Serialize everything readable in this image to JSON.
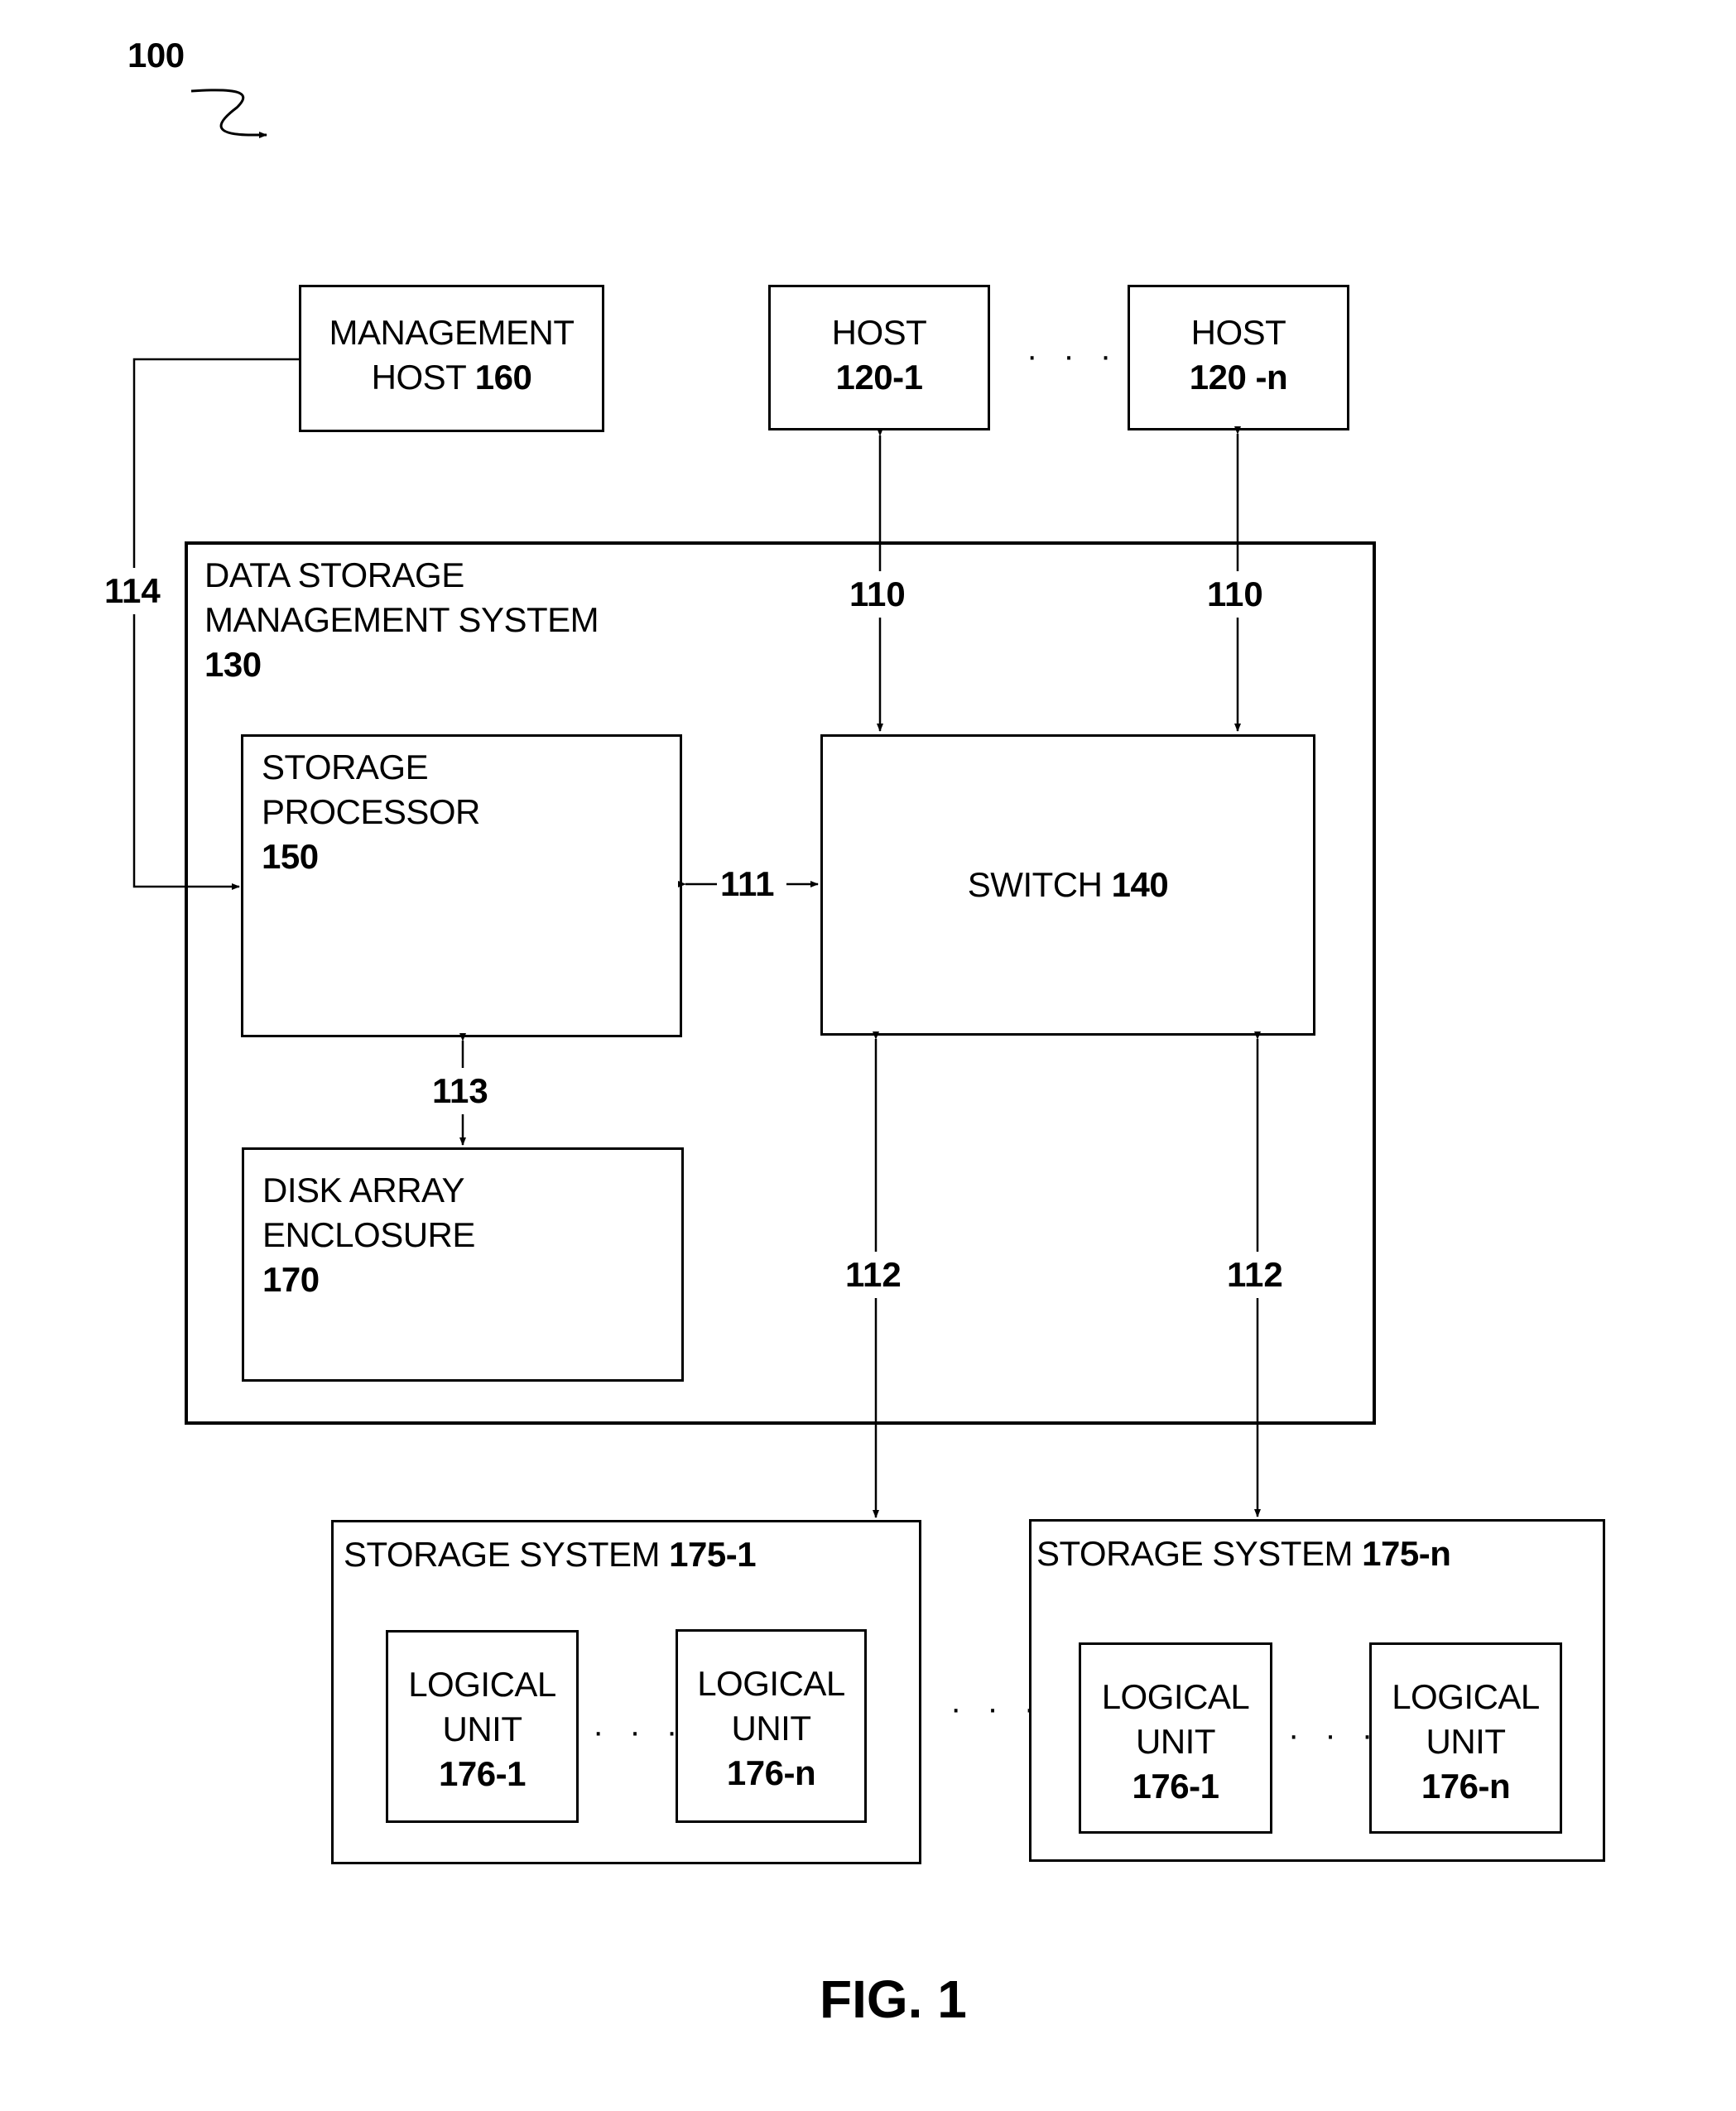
{
  "figure": {
    "reference": "100",
    "caption": "FIG. 1"
  },
  "nodes": {
    "management_host": {
      "title": "MANAGEMENT",
      "name": "HOST",
      "ref": "160"
    },
    "host_1": {
      "name": "HOST",
      "ref": "120-1"
    },
    "host_n": {
      "name": "HOST",
      "ref": "120 -n"
    },
    "data_storage_mgmt_system": {
      "line1": "DATA STORAGE",
      "line2": "MANAGEMENT SYSTEM",
      "ref": "130"
    },
    "storage_processor": {
      "line1": "STORAGE",
      "line2": "PROCESSOR",
      "ref": "150"
    },
    "switch": {
      "name": "SWITCH",
      "ref": "140"
    },
    "disk_array_enclosure": {
      "line1": "DISK ARRAY",
      "line2": "ENCLOSURE",
      "ref": "170"
    },
    "storage_system_1": {
      "name": "STORAGE SYSTEM",
      "ref": "175-1",
      "logical_units": [
        {
          "line1": "LOGICAL",
          "line2": "UNIT",
          "ref": "176-1"
        },
        {
          "line1": "LOGICAL",
          "line2": "UNIT",
          "ref": "176-n"
        }
      ]
    },
    "storage_system_n": {
      "name": "STORAGE SYSTEM",
      "ref": "175-n",
      "logical_units": [
        {
          "line1": "LOGICAL",
          "line2": "UNIT",
          "ref": "176-1"
        },
        {
          "line1": "LOGICAL",
          "line2": "UNIT",
          "ref": "176-n"
        }
      ]
    }
  },
  "connections": {
    "host_links": "110",
    "sp_switch_link": "111",
    "storage_links": "112",
    "sp_dae_link": "113",
    "mgmt_link": "114"
  },
  "ellipsis": "· · ·"
}
